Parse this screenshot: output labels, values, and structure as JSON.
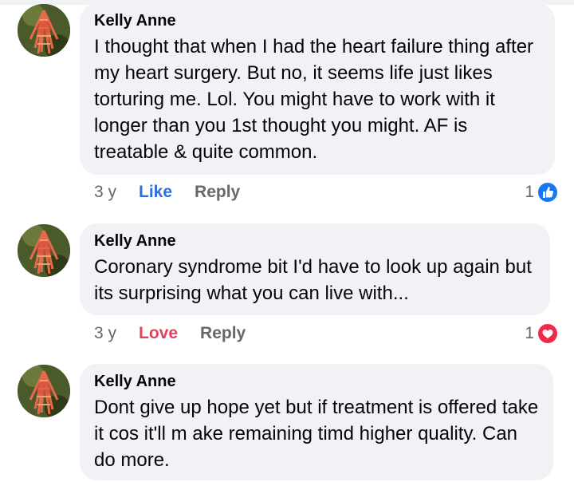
{
  "comments": [
    {
      "author": "Kelly Anne",
      "text": "I thought that when I had the heart failure thing after my heart surgery. But no, it seems life just likes torturing me. Lol. You might have to work with it longer than you 1st thought you might. AF is treatable & quite common.",
      "time": "3 y",
      "action": "Like",
      "reply": "Reply",
      "reaction_count": "1",
      "reaction_icon": "like-thumb-icon",
      "reaction_color": "#1877f2"
    },
    {
      "author": "Kelly Anne",
      "text": "Coronary syndrome bit I'd have to look up again but its surprising what you can live with...",
      "time": "3 y",
      "action": "Love",
      "reply": "Reply",
      "reaction_count": "1",
      "reaction_icon": "love-heart-icon",
      "reaction_color": "#f02849"
    },
    {
      "author": "Kelly Anne",
      "text": "Dont give up hope yet but if treatment is offered take it cos it'll m ake remaining timd higher quality. Can do more."
    }
  ],
  "colors": {
    "bubble": "#f0f2f5",
    "like_blue": "#2f6ed8",
    "love_red": "#e0435b",
    "meta_gray": "#65676b"
  }
}
